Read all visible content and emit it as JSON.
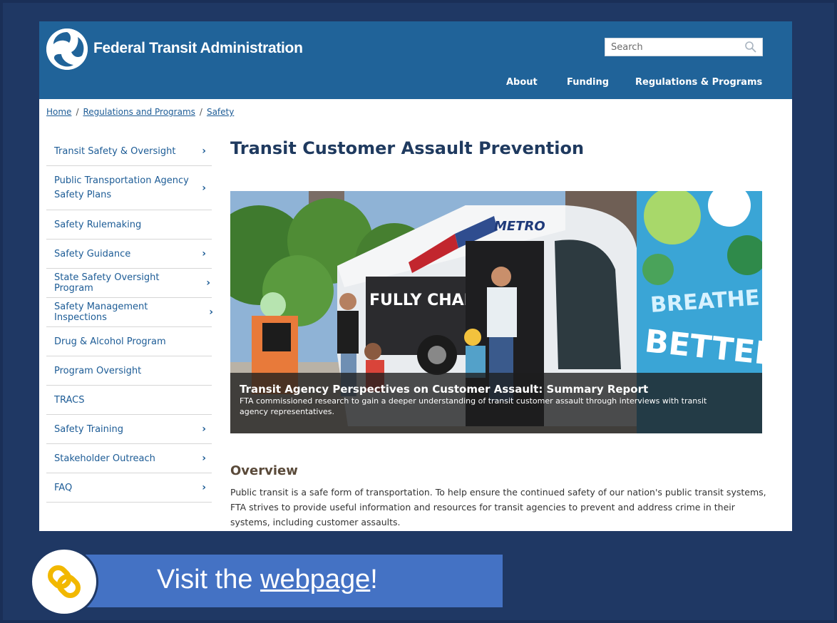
{
  "header": {
    "site_name": "Federal Transit Administration",
    "search_placeholder": "Search",
    "nav": [
      "About",
      "Funding",
      "Regulations & Programs"
    ]
  },
  "breadcrumb": [
    "Home",
    "Regulations and Programs",
    "Safety"
  ],
  "sidebar": {
    "items": [
      {
        "label": "Transit Safety & Oversight",
        "has_children": true
      },
      {
        "label": "Public Transportation Agency Safety Plans",
        "has_children": true
      },
      {
        "label": "Safety Rulemaking",
        "has_children": false
      },
      {
        "label": "Safety Guidance",
        "has_children": true
      },
      {
        "label": "State Safety Oversight Program",
        "has_children": true
      },
      {
        "label": "Safety Management Inspections",
        "has_children": true
      },
      {
        "label": "Drug & Alcohol Program",
        "has_children": false
      },
      {
        "label": "Program Oversight",
        "has_children": false
      },
      {
        "label": "TRACS",
        "has_children": false
      },
      {
        "label": "Safety Training",
        "has_children": true
      },
      {
        "label": "Stakeholder Outreach",
        "has_children": true
      },
      {
        "label": "FAQ",
        "has_children": true
      }
    ]
  },
  "main": {
    "title": "Transit Customer Assault Prevention",
    "hero": {
      "bus_brand": "METRO",
      "bus_side_text": "FULLY CHARGED",
      "banner_line1": "BREATHE",
      "banner_line2": "BETTER",
      "caption_title": "Transit Agency Perspectives on Customer Assault: Summary Report",
      "caption_text": "FTA commissioned research to gain a deeper understanding of transit customer assault through interviews with transit agency representatives."
    },
    "overview_heading": "Overview",
    "overview_text": "Public transit is a safe form of transportation. To help ensure the continued safety of our nation's public transit systems, FTA strives to provide useful information and resources for transit agencies to prevent and address crime in their systems, including customer assaults."
  },
  "banner": {
    "prefix": "Visit the ",
    "link": "webpage",
    "suffix": "!"
  },
  "colors": {
    "header_bg": "#206399",
    "page_bg": "#1f3864",
    "banner_bg": "#4472c4",
    "link_icon": "#f2b800"
  },
  "icons": [
    "fta-logo-icon",
    "search-icon",
    "chevron-right-icon",
    "chain-link-icon"
  ]
}
